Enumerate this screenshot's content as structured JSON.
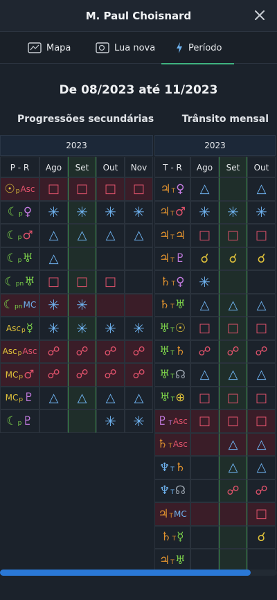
{
  "header": {
    "title": "M. Paul Choisnard"
  },
  "tabs": [
    {
      "label": "Mapa",
      "icon": "map-icon"
    },
    {
      "label": "Lua nova",
      "icon": "new-moon-icon"
    },
    {
      "label": "Período",
      "icon": "lightning-icon",
      "active": true
    }
  ],
  "period_title": "De 08/2023 até 11/2023",
  "left": {
    "label": "Progressões secundárias",
    "year": "2023",
    "headers": [
      "P - R",
      "Ago",
      "Set",
      "Out",
      "Nov"
    ],
    "rows": [
      {
        "p": [
          "☉",
          "p",
          "Asc"
        ],
        "pc": [
          "#e0c23a",
          "#e0c23a",
          "#e0526b"
        ],
        "red": true,
        "c": [
          "□",
          "□",
          "□",
          "□"
        ],
        "cc": [
          "#e0526b",
          "#e0526b",
          "#e0526b",
          "#e0526b"
        ]
      },
      {
        "p": [
          "☾",
          "p",
          "♀"
        ],
        "pc": [
          "#7cd14a",
          "#7cd14a",
          "#c37be0"
        ],
        "red": false,
        "c": [
          "✳",
          "✳",
          "✳",
          "✳"
        ],
        "cc": [
          "#6fb3f0",
          "#6fb3f0",
          "#6fb3f0",
          "#6fb3f0"
        ]
      },
      {
        "p": [
          "☾",
          "p",
          "♂"
        ],
        "pc": [
          "#7cd14a",
          "#7cd14a",
          "#e0526b"
        ],
        "red": false,
        "c": [
          "△",
          "△",
          "△",
          "△"
        ],
        "cc": [
          "#6fb3f0",
          "#6fb3f0",
          "#6fb3f0",
          "#6fb3f0"
        ]
      },
      {
        "p": [
          "☾",
          "p",
          "♅"
        ],
        "pc": [
          "#7cd14a",
          "#7cd14a",
          "#7cd14a"
        ],
        "red": false,
        "c": [
          "△",
          "",
          "",
          ""
        ],
        "cc": [
          "#6fb3f0",
          "",
          "",
          ""
        ]
      },
      {
        "p": [
          "☾",
          "pn",
          "♅"
        ],
        "pc": [
          "#7cd14a",
          "#7cd14a",
          "#7cd14a"
        ],
        "red": false,
        "c": [
          "□",
          "□",
          "□",
          ""
        ],
        "cc": [
          "#e0526b",
          "#e0526b",
          "#e0526b",
          ""
        ]
      },
      {
        "p": [
          "☾",
          "pn",
          "MC"
        ],
        "pc": [
          "#7cd14a",
          "#7cd14a",
          "#6fb3f0"
        ],
        "red": true,
        "c": [
          "✳",
          "✳",
          "",
          ""
        ],
        "cc": [
          "#6fb3f0",
          "#6fb3f0",
          "",
          ""
        ]
      },
      {
        "p": [
          "Asc",
          "p",
          "☿"
        ],
        "pc": [
          "#e0c23a",
          "#e0c23a",
          "#7cd14a"
        ],
        "red": false,
        "c": [
          "✳",
          "✳",
          "✳",
          "✳"
        ],
        "cc": [
          "#6fb3f0",
          "#6fb3f0",
          "#6fb3f0",
          "#6fb3f0"
        ]
      },
      {
        "p": [
          "Asc",
          "p",
          "Asc"
        ],
        "pc": [
          "#e0c23a",
          "#e0c23a",
          "#e0526b"
        ],
        "red": true,
        "c": [
          "☍",
          "☍",
          "☍",
          "☍"
        ],
        "cc": [
          "#e0526b",
          "#e0526b",
          "#e0526b",
          "#e0526b"
        ]
      },
      {
        "p": [
          "MC",
          "p",
          "♂"
        ],
        "pc": [
          "#e0c23a",
          "#e0c23a",
          "#e0526b"
        ],
        "red": true,
        "c": [
          "☍",
          "☍",
          "☍",
          "☍"
        ],
        "cc": [
          "#e0526b",
          "#e0526b",
          "#e0526b",
          "#e0526b"
        ]
      },
      {
        "p": [
          "MC",
          "p",
          "♇"
        ],
        "pc": [
          "#e0c23a",
          "#e0c23a",
          "#c37be0"
        ],
        "red": false,
        "c": [
          "△",
          "△",
          "△",
          "△"
        ],
        "cc": [
          "#6fb3f0",
          "#6fb3f0",
          "#6fb3f0",
          "#6fb3f0"
        ]
      },
      {
        "p": [
          "☾",
          "p",
          "♇"
        ],
        "pc": [
          "#7cd14a",
          "#7cd14a",
          "#c37be0"
        ],
        "red": false,
        "c": [
          "",
          "",
          "✳",
          "✳"
        ],
        "cc": [
          "",
          "",
          "#6fb3f0",
          "#6fb3f0"
        ]
      }
    ]
  },
  "right": {
    "label": "Trânsito mensal",
    "year": "2023",
    "headers": [
      "T - R",
      "Ago",
      "Set",
      "Out"
    ],
    "rows": [
      {
        "p": [
          "♃",
          "T",
          "♀"
        ],
        "pc": [
          "#e0922f",
          "#e0922f",
          "#c37be0"
        ],
        "red": false,
        "c": [
          "△",
          "",
          "△"
        ],
        "cc": [
          "#6fb3f0",
          "",
          "#6fb3f0"
        ]
      },
      {
        "p": [
          "♃",
          "T",
          "♂"
        ],
        "pc": [
          "#e0922f",
          "#e0922f",
          "#e0526b"
        ],
        "red": false,
        "c": [
          "✳",
          "✳",
          "✳"
        ],
        "cc": [
          "#6fb3f0",
          "#6fb3f0",
          "#6fb3f0"
        ]
      },
      {
        "p": [
          "♃",
          "T",
          "♃"
        ],
        "pc": [
          "#e0922f",
          "#e0922f",
          "#e0922f"
        ],
        "red": false,
        "c": [
          "□",
          "□",
          "□"
        ],
        "cc": [
          "#e0526b",
          "#e0526b",
          "#e0526b"
        ]
      },
      {
        "p": [
          "♃",
          "T",
          "♇"
        ],
        "pc": [
          "#e0922f",
          "#e0922f",
          "#c37be0"
        ],
        "red": false,
        "c": [
          "☌",
          "☌",
          "☌"
        ],
        "cc": [
          "#e0c23a",
          "#e0c23a",
          "#e0c23a"
        ]
      },
      {
        "p": [
          "♄",
          "T",
          "♀"
        ],
        "pc": [
          "#e0922f",
          "#e0922f",
          "#c37be0"
        ],
        "red": false,
        "c": [
          "✳",
          "",
          ""
        ],
        "cc": [
          "#6fb3f0",
          "",
          ""
        ]
      },
      {
        "p": [
          "♄",
          "T",
          "♅"
        ],
        "pc": [
          "#e0922f",
          "#e0922f",
          "#7cd14a"
        ],
        "red": false,
        "c": [
          "△",
          "△",
          "△"
        ],
        "cc": [
          "#6fb3f0",
          "#6fb3f0",
          "#6fb3f0"
        ]
      },
      {
        "p": [
          "♅",
          "T",
          "☉"
        ],
        "pc": [
          "#7cd14a",
          "#7cd14a",
          "#e0c23a"
        ],
        "red": false,
        "c": [
          "□",
          "□",
          "□"
        ],
        "cc": [
          "#e0526b",
          "#e0526b",
          "#e0526b"
        ]
      },
      {
        "p": [
          "♅",
          "T",
          "♄"
        ],
        "pc": [
          "#7cd14a",
          "#7cd14a",
          "#e0922f"
        ],
        "red": false,
        "c": [
          "☍",
          "☍",
          "☍"
        ],
        "cc": [
          "#e0526b",
          "#e0526b",
          "#e0526b"
        ]
      },
      {
        "p": [
          "♅",
          "T",
          "☊"
        ],
        "pc": [
          "#7cd14a",
          "#7cd14a",
          "#9aa3ad"
        ],
        "red": false,
        "c": [
          "△",
          "△",
          "△"
        ],
        "cc": [
          "#6fb3f0",
          "#6fb3f0",
          "#6fb3f0"
        ]
      },
      {
        "p": [
          "♅",
          "T",
          "⊕"
        ],
        "pc": [
          "#7cd14a",
          "#7cd14a",
          "#e0c23a"
        ],
        "red": false,
        "c": [
          "□",
          "□",
          "□"
        ],
        "cc": [
          "#e0526b",
          "#e0526b",
          "#e0526b"
        ]
      },
      {
        "p": [
          "♇",
          "T",
          "Asc"
        ],
        "pc": [
          "#c37be0",
          "#c37be0",
          "#e0526b"
        ],
        "red": true,
        "c": [
          "□",
          "□",
          "□"
        ],
        "cc": [
          "#e0526b",
          "#e0526b",
          "#e0526b"
        ]
      },
      {
        "p": [
          "♄",
          "T",
          "Asc"
        ],
        "pc": [
          "#e0922f",
          "#e0922f",
          "#e0526b"
        ],
        "red": true,
        "c": [
          "",
          "△",
          "△"
        ],
        "cc": [
          "",
          "#6fb3f0",
          "#6fb3f0"
        ]
      },
      {
        "p": [
          "♆",
          "T",
          "♄"
        ],
        "pc": [
          "#6fb3f0",
          "#6fb3f0",
          "#e0922f"
        ],
        "red": false,
        "c": [
          "",
          "△",
          "△"
        ],
        "cc": [
          "",
          "#6fb3f0",
          "#6fb3f0"
        ]
      },
      {
        "p": [
          "♆",
          "T",
          "☊"
        ],
        "pc": [
          "#6fb3f0",
          "#6fb3f0",
          "#9aa3ad"
        ],
        "red": false,
        "c": [
          "",
          "☍",
          "☍"
        ],
        "cc": [
          "",
          "#e0526b",
          "#e0526b"
        ]
      },
      {
        "p": [
          "♃",
          "T",
          "MC"
        ],
        "pc": [
          "#e0922f",
          "#e0922f",
          "#6fb3f0"
        ],
        "red": true,
        "c": [
          "",
          "",
          "□"
        ],
        "cc": [
          "",
          "",
          "#e0526b"
        ]
      },
      {
        "p": [
          "♄",
          "T",
          "☿"
        ],
        "pc": [
          "#e0922f",
          "#e0922f",
          "#7cd14a"
        ],
        "red": false,
        "c": [
          "",
          "",
          "☌"
        ],
        "cc": [
          "",
          "",
          "#e0c23a"
        ]
      },
      {
        "p": [
          "♃",
          "T",
          "♅"
        ],
        "pc": [
          "#e0922f",
          "#e0922f",
          "#7cd14a"
        ],
        "red": false,
        "c": [
          "",
          "",
          ""
        ],
        "cc": [
          "",
          "",
          ""
        ]
      }
    ]
  }
}
